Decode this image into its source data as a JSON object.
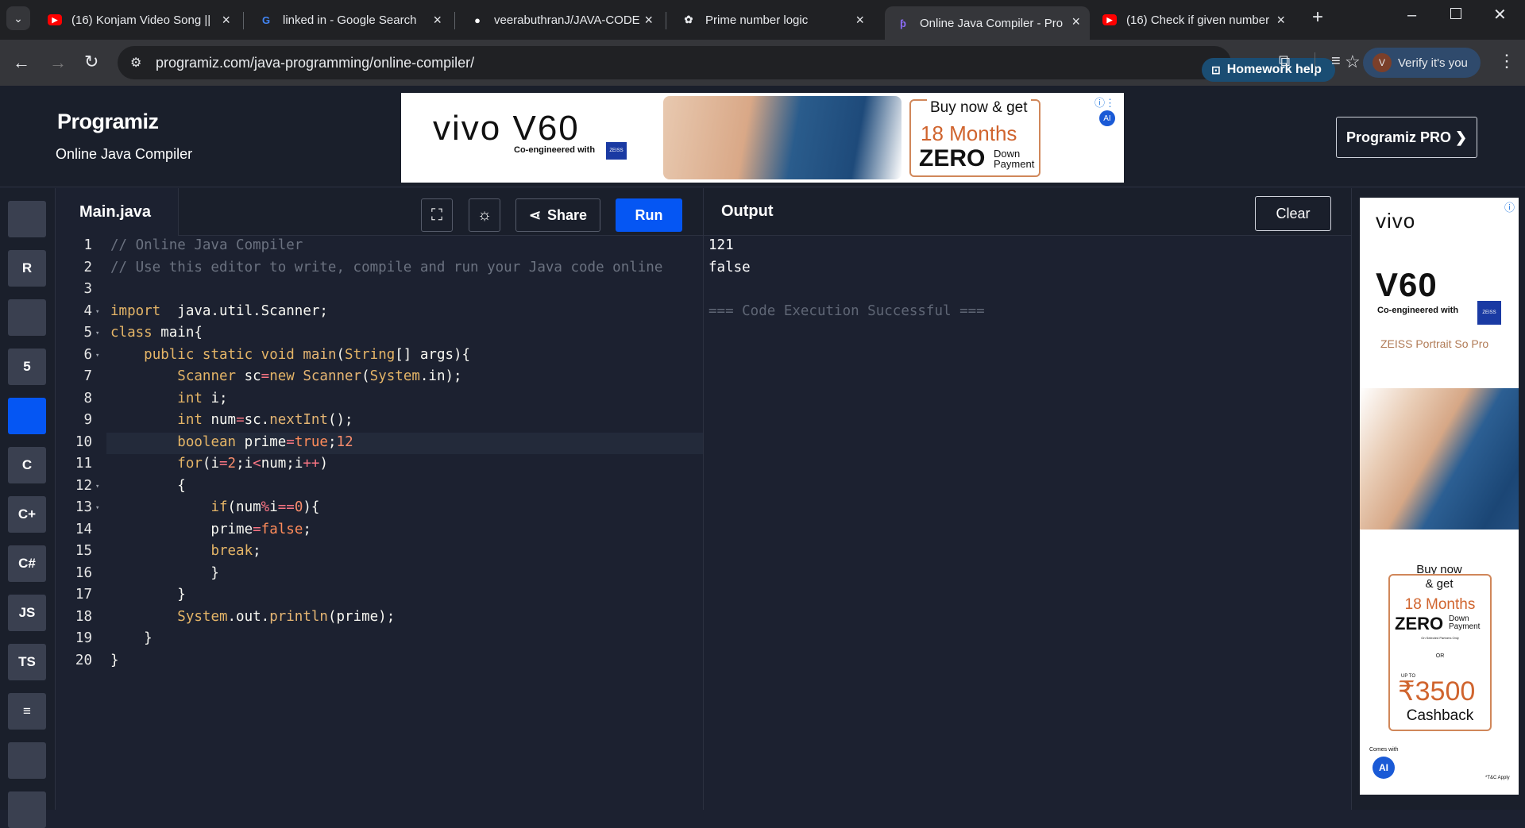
{
  "browser": {
    "tabs": [
      {
        "title": "(16) Konjam Video Song ||",
        "icon": "youtube-icon"
      },
      {
        "title": "linked in - Google Search",
        "icon": "google-icon"
      },
      {
        "title": "veerabuthranJ/JAVA-CODE",
        "icon": "github-icon"
      },
      {
        "title": "Prime number logic",
        "icon": "chatgpt-icon"
      },
      {
        "title": "Online Java Compiler - Pro",
        "icon": "programiz-icon",
        "active": true
      },
      {
        "title": "(16) Check if given number",
        "icon": "youtube-icon"
      }
    ],
    "url": "programiz.com/java-programming/online-compiler/",
    "homework_help": "Homework help",
    "verify": "Verify it's you",
    "avatar_letter": "V"
  },
  "header": {
    "logo": "Programiz",
    "subtitle": "Online Java Compiler",
    "pro_button": "Programiz PRO ❯"
  },
  "ad_top": {
    "brand": "vivo V60",
    "tagline": "Co-engineered with",
    "zeiss": "ZEISS",
    "offer_line1": "Buy now & get",
    "offer_line2": "18 Months",
    "offer_line3": "ZERO",
    "offer_line4a": "Down",
    "offer_line4b": "Payment"
  },
  "sidebar": {
    "languages": [
      {
        "name": "python",
        "glyph": "",
        "icon": "python-icon"
      },
      {
        "name": "r",
        "glyph": "R",
        "icon": "r-icon"
      },
      {
        "name": "sql",
        "glyph": "",
        "icon": "database-icon"
      },
      {
        "name": "html",
        "glyph": "5",
        "icon": "html5-icon"
      },
      {
        "name": "java",
        "glyph": "",
        "icon": "java-icon",
        "active": true
      },
      {
        "name": "c",
        "glyph": "C",
        "icon": "c-icon"
      },
      {
        "name": "cpp",
        "glyph": "C+",
        "icon": "cpp-icon"
      },
      {
        "name": "csharp",
        "glyph": "C#",
        "icon": "csharp-icon"
      },
      {
        "name": "js",
        "glyph": "JS",
        "icon": "javascript-icon"
      },
      {
        "name": "ts",
        "glyph": "TS",
        "icon": "typescript-icon"
      },
      {
        "name": "go",
        "glyph": "≡",
        "icon": "go-icon"
      },
      {
        "name": "swift",
        "glyph": "",
        "icon": "swift-icon"
      },
      {
        "name": "rust",
        "glyph": "",
        "icon": "rust-icon"
      }
    ]
  },
  "editor": {
    "filename": "Main.java",
    "share": "Share",
    "run": "Run",
    "current_line": 10,
    "lines": [
      {
        "n": "1",
        "fold": false
      },
      {
        "n": "2",
        "fold": false
      },
      {
        "n": "3",
        "fold": false
      },
      {
        "n": "4",
        "fold": true
      },
      {
        "n": "5",
        "fold": true
      },
      {
        "n": "6",
        "fold": true
      },
      {
        "n": "7",
        "fold": false
      },
      {
        "n": "8",
        "fold": false
      },
      {
        "n": "9",
        "fold": false
      },
      {
        "n": "10",
        "fold": false
      },
      {
        "n": "11",
        "fold": false
      },
      {
        "n": "12",
        "fold": true
      },
      {
        "n": "13",
        "fold": true
      },
      {
        "n": "14",
        "fold": false
      },
      {
        "n": "15",
        "fold": false
      },
      {
        "n": "16",
        "fold": false
      },
      {
        "n": "17",
        "fold": false
      },
      {
        "n": "18",
        "fold": false
      },
      {
        "n": "19",
        "fold": false
      },
      {
        "n": "20",
        "fold": false
      }
    ],
    "code": [
      [
        [
          "c-com",
          "// Online Java Compiler"
        ]
      ],
      [
        [
          "c-com",
          "// Use this editor to write, compile and run your Java code online"
        ]
      ],
      [],
      [
        [
          "c-kw",
          "import"
        ],
        [
          "",
          "  java.util.Scanner;"
        ]
      ],
      [
        [
          "c-kw",
          "class"
        ],
        [
          "",
          " main{"
        ]
      ],
      [
        [
          "",
          "    "
        ],
        [
          "c-kw",
          "public static void"
        ],
        [
          "",
          ""
        ],
        [
          "c-fn",
          " main"
        ],
        [
          "",
          "("
        ],
        [
          "c-kw",
          "String"
        ],
        [
          "",
          "[] args){"
        ]
      ],
      [
        [
          "",
          "        "
        ],
        [
          "c-kw",
          "Scanner"
        ],
        [
          "",
          " sc"
        ],
        [
          "c-op",
          "="
        ],
        [
          "c-kw",
          "new"
        ],
        [
          "c-fn",
          " Scanner"
        ],
        [
          "",
          "("
        ],
        [
          "c-kw",
          "System"
        ],
        [
          "",
          ".in);"
        ]
      ],
      [
        [
          "",
          "        "
        ],
        [
          "c-kw",
          "int"
        ],
        [
          "",
          " i;"
        ]
      ],
      [
        [
          "",
          "        "
        ],
        [
          "c-kw",
          "int"
        ],
        [
          "",
          " num"
        ],
        [
          "c-op",
          "="
        ],
        [
          "",
          "sc."
        ],
        [
          "c-fn",
          "nextInt"
        ],
        [
          "",
          "();"
        ]
      ],
      [
        [
          "",
          "        "
        ],
        [
          "c-kw",
          "boolean"
        ],
        [
          "",
          " prime"
        ],
        [
          "c-op",
          "="
        ],
        [
          "c-bool",
          "true"
        ],
        [
          "",
          ";"
        ],
        [
          "c-num",
          "12"
        ]
      ],
      [
        [
          "",
          "        "
        ],
        [
          "c-kw",
          "for"
        ],
        [
          "",
          "(i"
        ],
        [
          "c-op",
          "="
        ],
        [
          "c-num",
          "2"
        ],
        [
          "",
          ";i"
        ],
        [
          "c-op",
          "<"
        ],
        [
          "",
          "num;i"
        ],
        [
          "c-op",
          "++"
        ],
        [
          "",
          ")"
        ]
      ],
      [
        [
          "",
          "        {"
        ]
      ],
      [
        [
          "",
          "            "
        ],
        [
          "c-kw",
          "if"
        ],
        [
          "",
          "(num"
        ],
        [
          "c-op",
          "%"
        ],
        [
          "",
          "i"
        ],
        [
          "c-op",
          "=="
        ],
        [
          "c-num",
          "0"
        ],
        [
          "",
          "){"
        ]
      ],
      [
        [
          "",
          "            prime"
        ],
        [
          "c-op",
          "="
        ],
        [
          "c-bool",
          "false"
        ],
        [
          "",
          ";"
        ]
      ],
      [
        [
          "",
          "            "
        ],
        [
          "c-kw",
          "break"
        ],
        [
          "",
          ";"
        ]
      ],
      [
        [
          "",
          "            }"
        ]
      ],
      [
        [
          "",
          "        }"
        ]
      ],
      [
        [
          "",
          "        "
        ],
        [
          "c-kw",
          "System"
        ],
        [
          "",
          ".out."
        ],
        [
          "c-fn",
          "println"
        ],
        [
          "",
          "(prime);"
        ]
      ],
      [
        [
          "",
          "    }"
        ]
      ],
      [
        [
          "",
          "}"
        ]
      ]
    ]
  },
  "output": {
    "title": "Output",
    "clear": "Clear",
    "lines": [
      "121",
      "false",
      "",
      "=== Code Execution Successful ==="
    ]
  },
  "ad_side": {
    "brand": "vivo",
    "model": "V60",
    "tagline": "Co-engineered with",
    "zeiss": "ZEISS",
    "portrait": "ZEISS Portrait So Pro",
    "buy": "Buy now",
    "get": "& get",
    "months": "18 Months",
    "zero": "ZERO",
    "down": "Down",
    "payment": "Payment",
    "small": "On Selected Partners Only",
    "or": "OR",
    "upto": "UP TO",
    "amount": "₹3500",
    "cashback": "Cashback",
    "comes": "Comes with",
    "ai": "AI",
    "tc": "*T&C Apply"
  },
  "colors": {
    "accent": "#0556f3",
    "bg": "#1c2130",
    "header_bg": "#1a1f2b"
  }
}
